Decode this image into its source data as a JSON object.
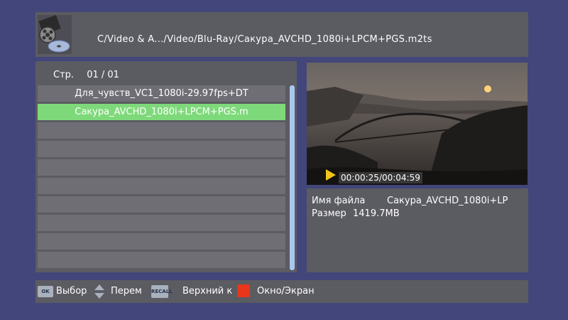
{
  "header": {
    "path": "C/Video & A.../Video/Blu-Ray/Сакура_AVCHD_1080i+LPCM+PGS.m2ts",
    "logo_icon": "film-reel-disc-icon"
  },
  "browser": {
    "page_label": "Стр.",
    "page_value": "01 / 01",
    "files": [
      "Для_чувств_VC1_1080i-29.97fps+DT",
      "Сакура_AVCHD_1080i+LPCM+PGS.m"
    ],
    "selected_index": 1,
    "empty_rows": 8,
    "accent_color": "#7ed97a"
  },
  "preview": {
    "timecode": "00:00:25/00:04:59",
    "play_icon": "play-triangle-icon"
  },
  "info": {
    "filename_label": "Имя файла",
    "filename_value": "Сакура_AVCHD_1080i+LP",
    "size_label": "Размер",
    "size_value": "1419.7MB"
  },
  "footer": {
    "ok_key": "OK",
    "ok_label": "Выбор",
    "move_label": "Перем",
    "recall_key": "RECALL",
    "recall_label": "Верхний к",
    "red_label": "Окно/Экран",
    "red_color": "#e8361a"
  }
}
